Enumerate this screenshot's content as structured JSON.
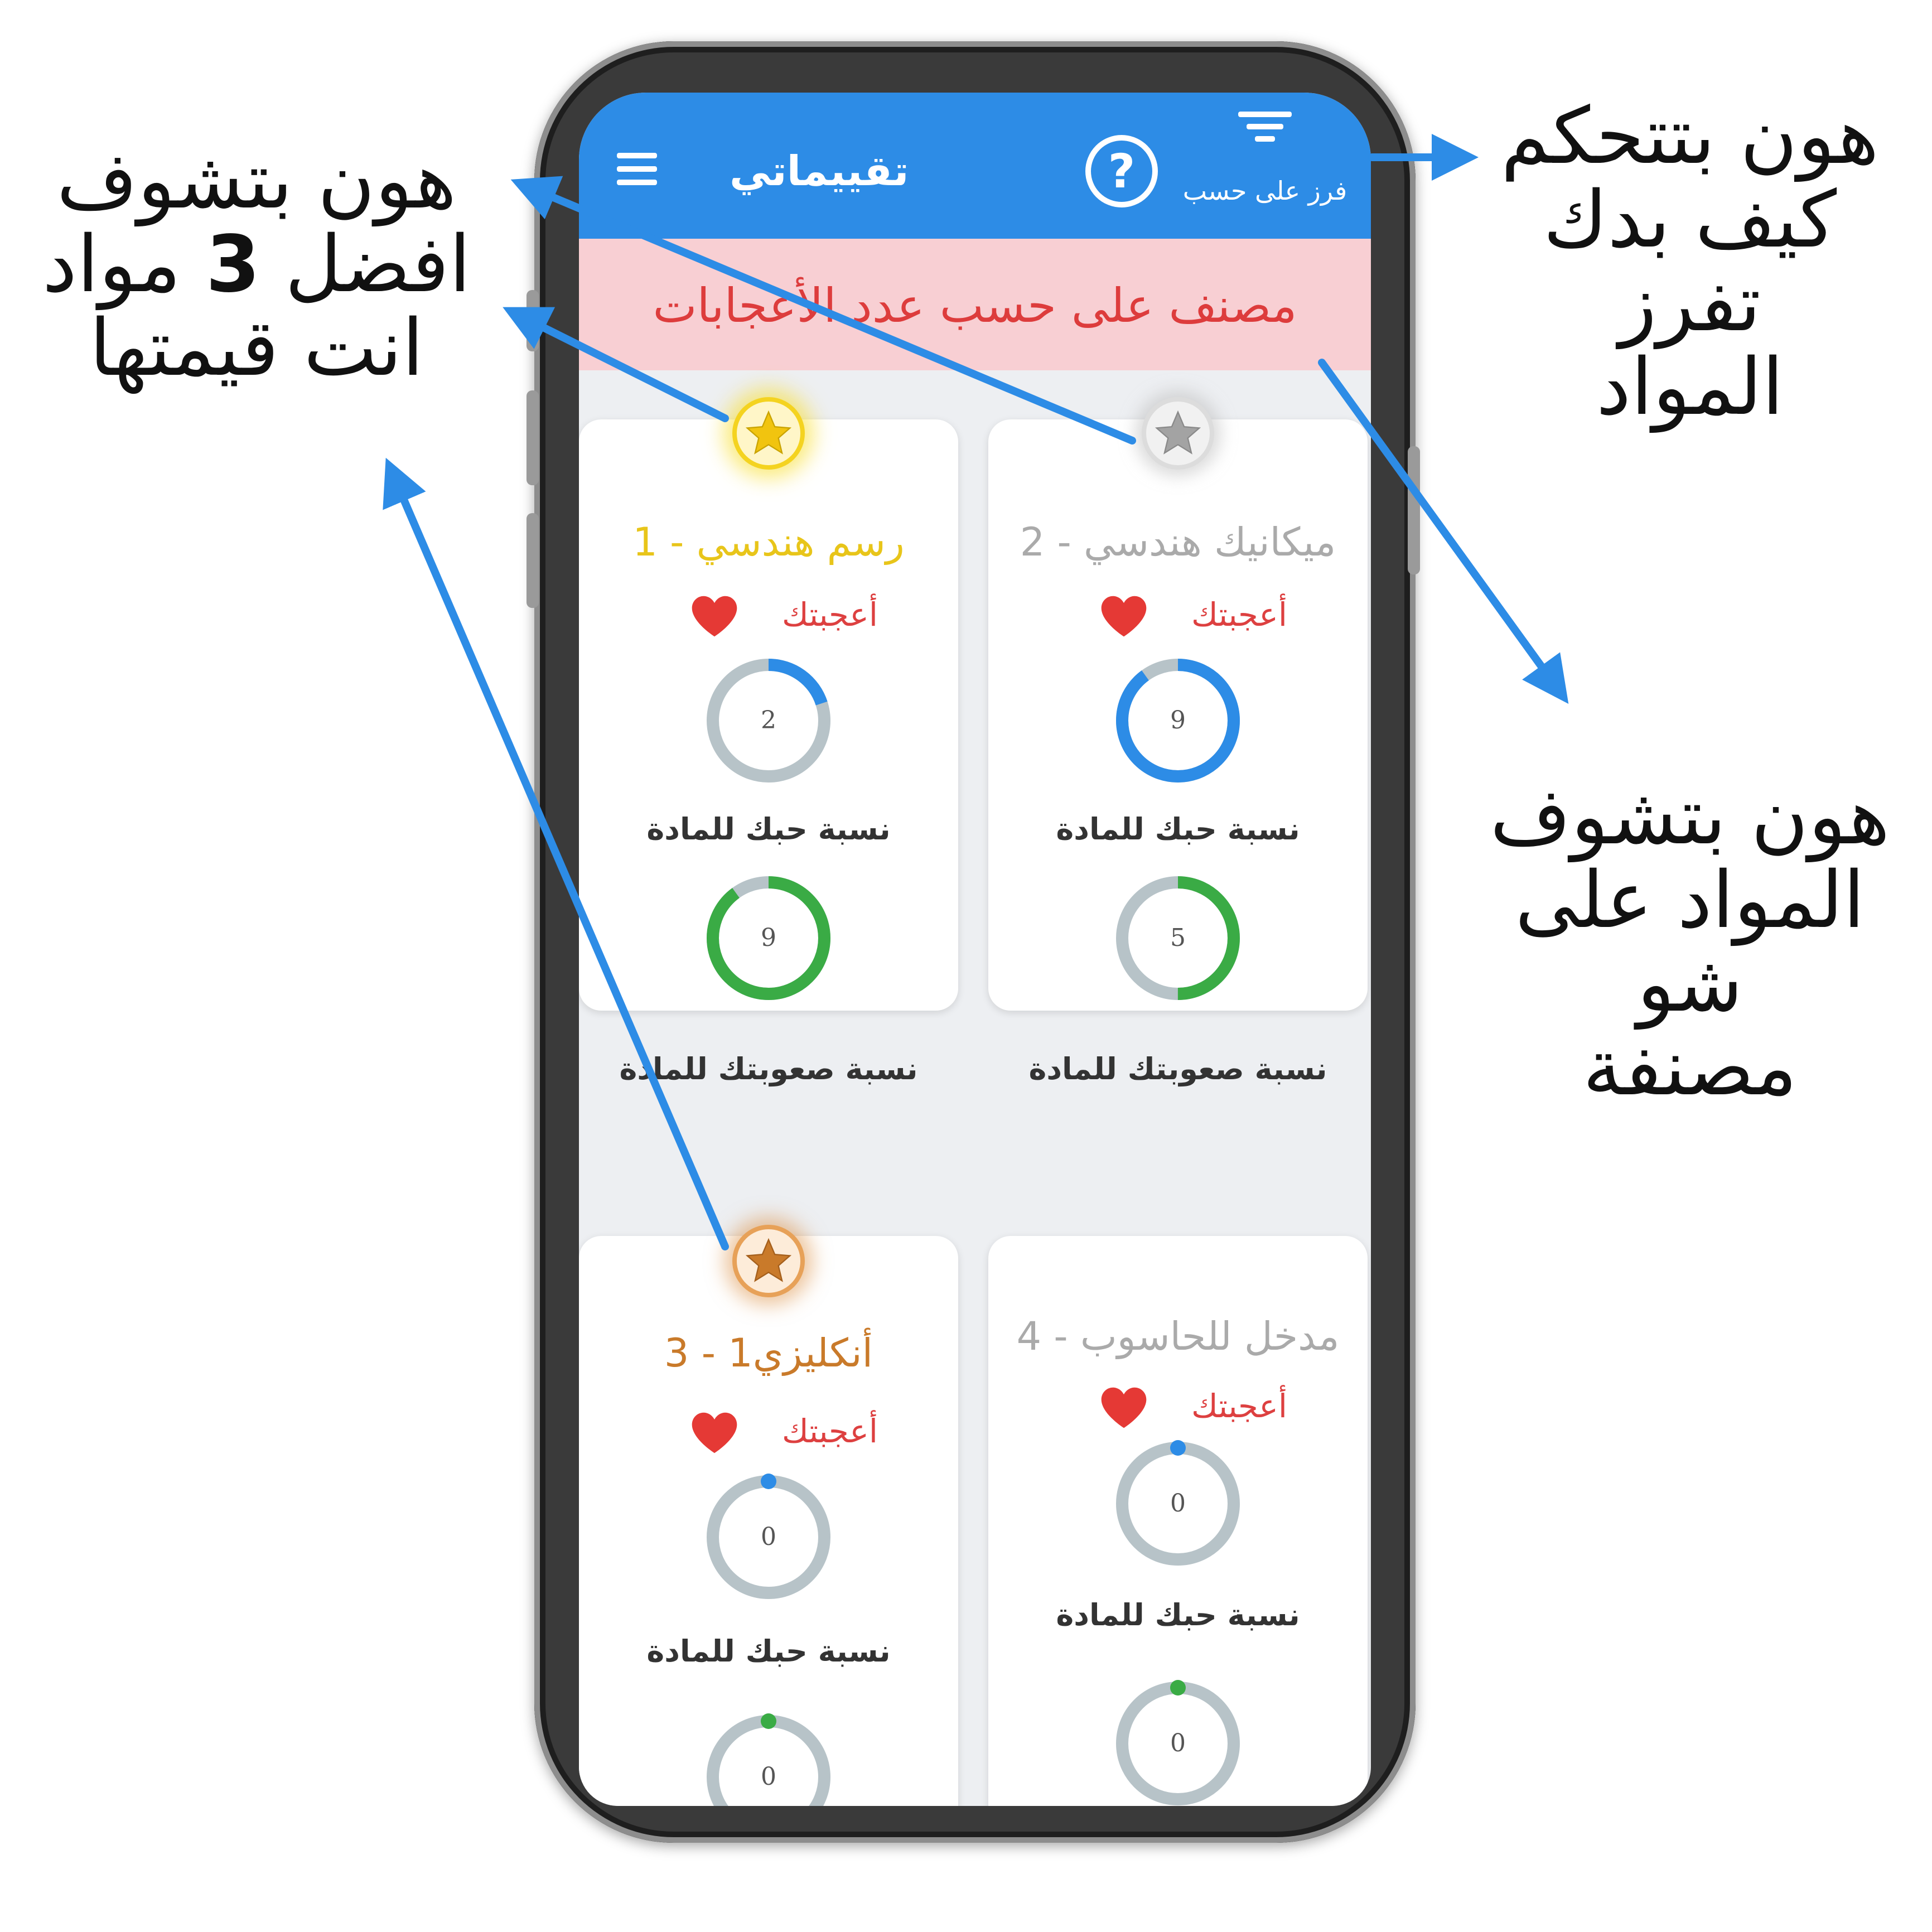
{
  "app": {
    "title": "تقييماتي",
    "help_glyph": "?",
    "sort_label": "فرز على حسب",
    "menu_icon": "hamburger-menu-icon",
    "filter_icon": "filter-icon"
  },
  "banner": {
    "text": "مصنف على حسب عدد الأعجابات"
  },
  "labels": {
    "liked": "أعجبتك",
    "like_ratio": "نسبة حبك للمادة",
    "difficulty_ratio": "نسبة صعوبتك للمادة"
  },
  "courses": [
    {
      "title": "1 - رسم هندسي",
      "rank": "gold",
      "like_value": "2",
      "like_fill": 0.2,
      "difficulty_value": "9",
      "difficulty_fill": 0.9
    },
    {
      "title": "2 - ميكانيك هندسي",
      "rank": "silver",
      "like_value": "9",
      "like_fill": 0.9,
      "difficulty_value": "5",
      "difficulty_fill": 0.5
    },
    {
      "title": "3 - أنكليزي1",
      "rank": "bronze",
      "like_value": "0",
      "like_fill": 0,
      "difficulty_value": "0",
      "difficulty_fill": 0
    },
    {
      "title": "4 - مدخل للحاسوب",
      "rank": "none",
      "like_value": "0",
      "like_fill": 0,
      "difficulty_value": "0",
      "difficulty_fill": 0
    }
  ],
  "annotations": {
    "top_left_line1": "هون بتشوف",
    "top_left_line2_pre": "افضل",
    "top_left_line2_num": "3",
    "top_left_line2_post": "مواد",
    "top_left_line3": "انت قيمتها",
    "top_right_line1": "هون بتتحكم",
    "top_right_line2": "كيف بدك تفرز",
    "top_right_line3": "المواد",
    "mid_right_line1": "هون بتشوف",
    "mid_right_line2": "المواد على شو",
    "mid_right_line3": "مصنفة"
  },
  "colors": {
    "app_bar": "#2d8ce6",
    "banner_bg": "#f8cfd3",
    "banner_text": "#dd3c3c",
    "gold": "#e8c51a",
    "silver": "#aaaaaa",
    "bronze": "#c97a2a",
    "like_ring": "#2d8ce6",
    "difficulty_ring": "#3aab45",
    "ring_track": "#b7c3c8",
    "heart": "#e53935",
    "arrow": "#2d8ce6"
  }
}
